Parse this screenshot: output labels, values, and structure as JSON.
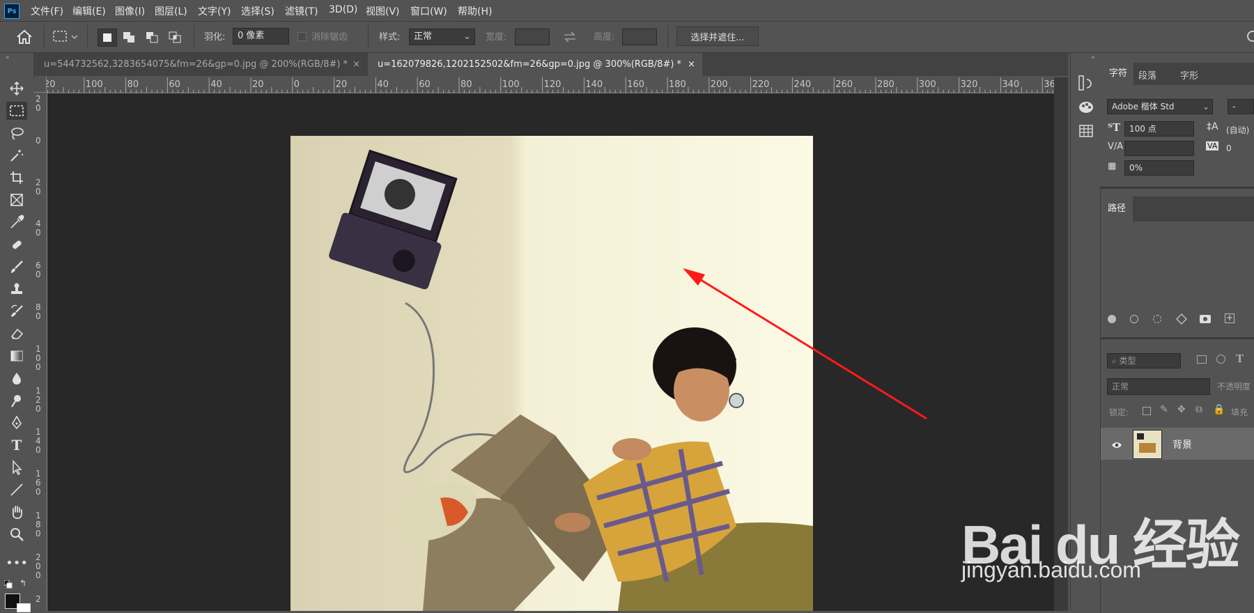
{
  "app": {
    "logo": "Ps"
  },
  "menu": [
    "文件(F)",
    "编辑(E)",
    "图像(I)",
    "图层(L)",
    "文字(Y)",
    "选择(S)",
    "滤镜(T)",
    "3D(D)",
    "视图(V)",
    "窗口(W)",
    "帮助(H)"
  ],
  "options": {
    "feather_label": "羽化:",
    "feather_value": "0 像素",
    "antialias_label": "消除锯齿",
    "style_label": "样式:",
    "style_value": "正常",
    "width_label": "宽度:",
    "height_label": "高度:",
    "select_mask_button": "选择并遮住..."
  },
  "tabs": [
    {
      "title": "u=544732562,3283654075&fm=26&gp=0.jpg @ 200%(RGB/8#) *",
      "active": false
    },
    {
      "title": "u=162079826,1202152502&fm=26&gp=0.jpg @ 300%(RGB/8#) *",
      "active": true
    }
  ],
  "ruler_h": [
    "20",
    "100",
    "80",
    "60",
    "40",
    "20",
    "0",
    "20",
    "40",
    "60",
    "80",
    "100",
    "120",
    "140",
    "160",
    "180",
    "200",
    "220",
    "240",
    "260",
    "280",
    "300",
    "320",
    "340",
    "36"
  ],
  "ruler_v": [
    "20",
    "0",
    "20",
    "40",
    "60",
    "80",
    "100",
    "120",
    "140",
    "160",
    "180",
    "200",
    "2"
  ],
  "character_panel": {
    "tabs": [
      "字符",
      "段落",
      "字形"
    ],
    "font_family": "Adobe 楷体 Std",
    "font_style": "-",
    "size": "100 点",
    "leading": "(自动)",
    "tracking": "0",
    "scale": "0%"
  },
  "paths_panel": {
    "tab": "路径"
  },
  "layers_panel": {
    "filter_label": "类型",
    "blend_mode": "正常",
    "opacity_label": "不透明度",
    "lock_label": "锁定:",
    "fill_label": "填充",
    "layers": [
      {
        "name": "背景",
        "visible": true
      }
    ]
  },
  "watermark": {
    "brand": "Bai du 经验",
    "url": "jingyan.baidu.com"
  },
  "colors": {
    "accent": "#31a8ff",
    "arrow": "#ff1a1a",
    "canvas_bg": "#282828",
    "panel_bg": "#535353"
  }
}
